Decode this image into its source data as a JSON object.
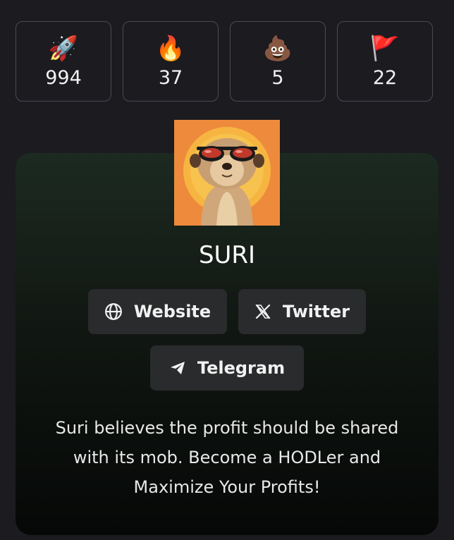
{
  "stats": [
    {
      "icon": "rocket-icon",
      "emoji": "🚀",
      "count": "994"
    },
    {
      "icon": "fire-icon",
      "emoji": "🔥",
      "count": "37"
    },
    {
      "icon": "poop-icon",
      "emoji": "💩",
      "count": "5"
    },
    {
      "icon": "red-flag-icon",
      "emoji": "🚩",
      "count": "22"
    }
  ],
  "token": {
    "name": "SURI",
    "description": "Suri believes the profit should be shared with its mob. Become a HODLer and Maximize Your Profits!"
  },
  "links": {
    "website_label": "Website",
    "twitter_label": "Twitter",
    "telegram_label": "Telegram"
  },
  "colors": {
    "page_bg": "#1b1b20",
    "card_top": "#1c2a21",
    "card_bottom": "#060807",
    "button_bg": "#2a2b2c",
    "avatar_bg": "#ee8a3c"
  }
}
